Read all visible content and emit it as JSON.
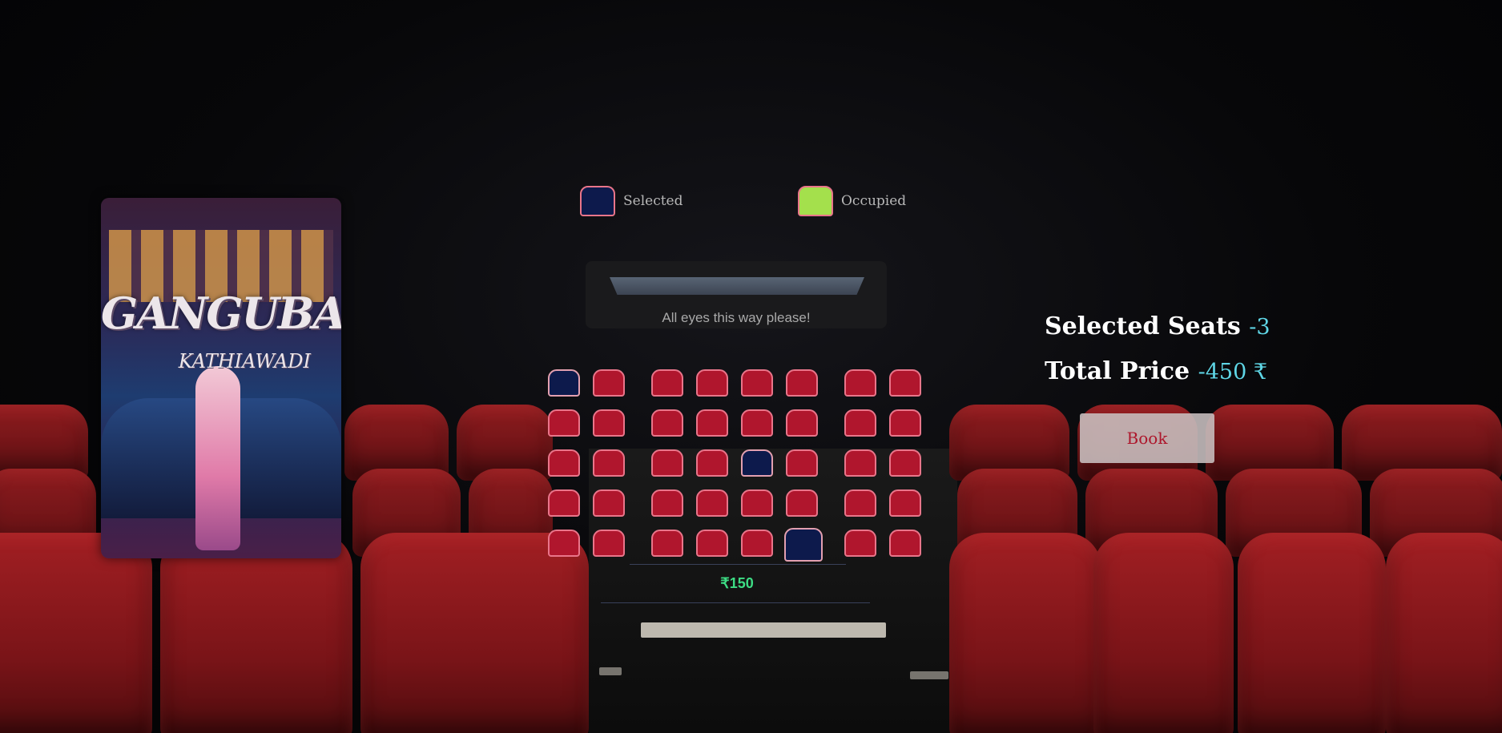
{
  "legend": {
    "selected_label": "Selected",
    "occupied_label": "Occupied",
    "selected_color": "#0d1a4c",
    "occupied_color": "#a4e04c"
  },
  "screen": {
    "caption": "All eyes this way please!"
  },
  "seat_colors": {
    "available": "#b0162d",
    "selected": "#0d1a4c",
    "border": "#e9758a"
  },
  "seat_map": {
    "rows": 5,
    "blocks": [
      2,
      4,
      2
    ],
    "selected": [
      [
        0,
        0
      ],
      [
        2,
        4
      ],
      [
        4,
        5
      ]
    ]
  },
  "price_tier": {
    "label": "₹150"
  },
  "summary": {
    "selected_seats_label": "Selected Seats",
    "selected_seats_value": "-3",
    "total_price_label": "Total Price",
    "total_price_value": "-450 ₹"
  },
  "book_button": {
    "label": "Book"
  },
  "poster": {
    "title": "GANGUBAI",
    "subtitle": "KATHIAWADI"
  }
}
